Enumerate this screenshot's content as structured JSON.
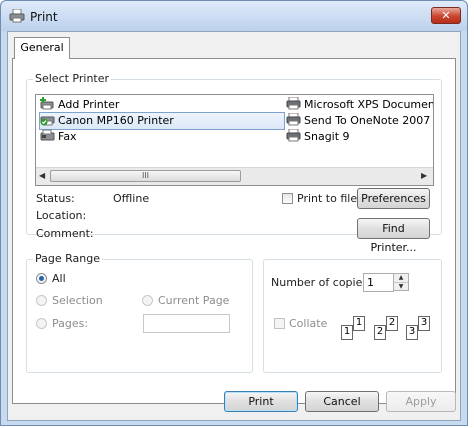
{
  "window": {
    "title": "Print",
    "close_glyph": "✕"
  },
  "tabs": [
    {
      "label": "General",
      "active": true
    }
  ],
  "select_printer": {
    "group_label": "Select Printer",
    "printers": [
      {
        "name": "Add Printer",
        "icon": "add-printer-icon",
        "selected": false
      },
      {
        "name": "Canon MP160 Printer",
        "icon": "printer-default-icon",
        "selected": true
      },
      {
        "name": "Fax",
        "icon": "fax-icon",
        "selected": false
      },
      {
        "name": "Microsoft XPS Document Writer",
        "icon": "printer-icon",
        "selected": false
      },
      {
        "name": "Send To OneNote 2007",
        "icon": "printer-icon",
        "selected": false
      },
      {
        "name": "Snagit 9",
        "icon": "printer-icon",
        "selected": false
      }
    ],
    "scroll_left": "◀",
    "scroll_right": "▶",
    "scroll_grip": "III",
    "status_label": "Status:",
    "status_value": "Offline",
    "location_label": "Location:",
    "location_value": "",
    "comment_label": "Comment:",
    "comment_value": "",
    "print_to_file_label": "Print to file",
    "print_to_file_checked": false,
    "preferences_label": "Preferences",
    "find_printer_label": "Find Printer..."
  },
  "page_range": {
    "group_label": "Page Range",
    "options": {
      "all": "All",
      "selection": "Selection",
      "current_page": "Current Page",
      "pages": "Pages:"
    },
    "selected": "all",
    "pages_value": ""
  },
  "copies": {
    "label": "Number of copies:",
    "value": "1",
    "collate_label": "Collate",
    "collate_checked": false,
    "collate_pages": [
      "1",
      "1",
      "2",
      "2",
      "3",
      "3"
    ]
  },
  "buttons": {
    "print": "Print",
    "cancel": "Cancel",
    "apply": "Apply"
  },
  "colors": {
    "selected_bg": "#dbe8f8",
    "default_border": "#3c7fb1",
    "close_red": "#c9452f",
    "title_bar": "#dfeafa"
  }
}
